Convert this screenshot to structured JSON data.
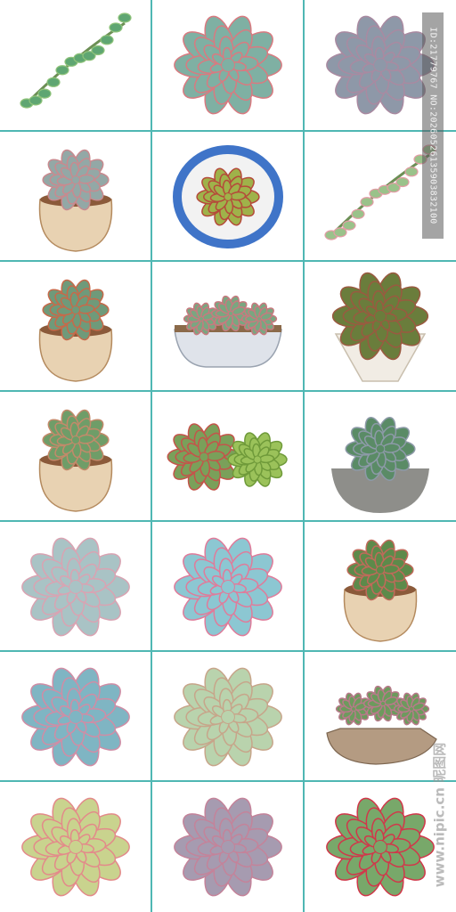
{
  "watermark": {
    "id_text": "ID:21779767 NO:20260526135903832100",
    "site_text": "www.nipic.cn 昵图网"
  },
  "colors": {
    "grid_line": "#4fb7b3",
    "background": "#ffffff"
  },
  "cells": [
    {
      "name": "trailing-succulent-stem",
      "pot": "none",
      "plant": "#5fa672",
      "tip": "#8fc37a"
    },
    {
      "name": "blue-green-echeveria-pink-tips",
      "pot": "none",
      "plant": "#7fb0a3",
      "tip": "#d97a80"
    },
    {
      "name": "grey-purple-echeveria",
      "pot": "none",
      "plant": "#8e98a8",
      "tip": "#a98aa1"
    },
    {
      "name": "sagittarius-ceramic-pot-succulent",
      "pot": "beige",
      "plant": "#93a8a6",
      "tip": "#c88a8f"
    },
    {
      "name": "blue-rim-bowl-sempervivum",
      "pot": "blue-bowl",
      "plant": "#9fb24a",
      "tip": "#b54a3a"
    },
    {
      "name": "pink-jelly-bean-branches",
      "pot": "none",
      "plant": "#9ac28a",
      "tip": "#e39ca5"
    },
    {
      "name": "aries-ceramic-pot-succulents",
      "pot": "beige",
      "plant": "#6f9a7a",
      "tip": "#c66a4a"
    },
    {
      "name": "bathtub-planter-succulents",
      "pot": "white-tub",
      "plant": "#7aa680",
      "tip": "#c77a7f"
    },
    {
      "name": "dark-green-rosette-white-pot",
      "pot": "white",
      "plant": "#6a7d3c",
      "tip": "#9a5a40"
    },
    {
      "name": "taurus-cart-pot-succulents",
      "pot": "beige",
      "plant": "#6f9d68",
      "tip": "#c28a6a"
    },
    {
      "name": "two-green-red-rosettes",
      "pot": "none",
      "plant": "#7aa05a",
      "tip": "#c4544a"
    },
    {
      "name": "haworthia-grey-bowl",
      "pot": "grey-bowl",
      "plant": "#5a8b66",
      "tip": "#8d9aa8"
    },
    {
      "name": "pale-blue-echeveria",
      "pot": "none",
      "plant": "#a9c3c5",
      "tip": "#d9a3b2"
    },
    {
      "name": "pink-blue-echeveria",
      "pot": "none",
      "plant": "#8cc7d2",
      "tip": "#e07b9a"
    },
    {
      "name": "cactus-clay-pot",
      "pot": "beige",
      "plant": "#5d8a4a",
      "tip": "#c06a5a"
    },
    {
      "name": "blue-echeveria-large",
      "pot": "none",
      "plant": "#7fb5c3",
      "tip": "#d08da5"
    },
    {
      "name": "pale-green-echeveria",
      "pot": "none",
      "plant": "#b9d3ad",
      "tip": "#c7a58a"
    },
    {
      "name": "rock-garden-succulents",
      "pot": "rock",
      "plant": "#6d9a5d",
      "tip": "#b87a8a"
    },
    {
      "name": "peach-yellow-echeveria",
      "pot": "none",
      "plant": "#c9d38e",
      "tip": "#e38a8a"
    },
    {
      "name": "lavender-echeveria",
      "pot": "none",
      "plant": "#a69bb0",
      "tip": "#c4839a"
    },
    {
      "name": "red-edged-green-echeveria",
      "pot": "none",
      "plant": "#78a86a",
      "tip": "#d1374a"
    }
  ]
}
